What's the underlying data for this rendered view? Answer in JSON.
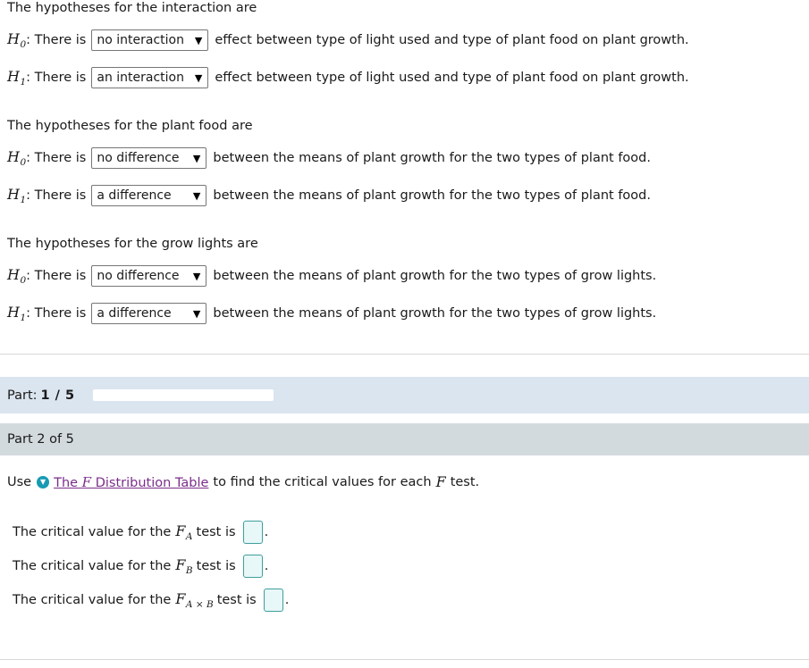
{
  "hypotheses_sections": [
    {
      "intro": "The hypotheses for the interaction are",
      "rows": [
        {
          "symbol": "H",
          "subscript": "0",
          "text_before": ": There is",
          "selected": "no interaction",
          "options": [
            "no interaction",
            "an interaction"
          ],
          "text_after": "effect between type of light used and type of plant food on plant growth."
        },
        {
          "symbol": "H",
          "subscript": "1",
          "text_before": ": There is",
          "selected": "an interaction",
          "options": [
            "no interaction",
            "an interaction"
          ],
          "text_after": "effect between type of light used and type of plant food on plant growth."
        }
      ]
    },
    {
      "intro": "The hypotheses for the plant food are",
      "rows": [
        {
          "symbol": "H",
          "subscript": "0",
          "text_before": ": There is",
          "selected": "no difference",
          "options": [
            "no difference",
            "a difference"
          ],
          "text_after": "between the means of plant growth for the two types of plant food."
        },
        {
          "symbol": "H",
          "subscript": "1",
          "text_before": ": There is",
          "selected": "a difference",
          "options": [
            "no difference",
            "a difference"
          ],
          "text_after": "between the means of plant growth for the two types of plant food."
        }
      ]
    },
    {
      "intro": "The hypotheses for the grow lights are",
      "rows": [
        {
          "symbol": "H",
          "subscript": "0",
          "text_before": ": There is",
          "selected": "no difference",
          "options": [
            "no difference",
            "a difference"
          ],
          "text_after": "between the means of plant growth for the two types of grow lights."
        },
        {
          "symbol": "H",
          "subscript": "1",
          "text_before": ": There is",
          "selected": "a difference",
          "options": [
            "no difference",
            "a difference"
          ],
          "text_after": "between the means of plant growth for the two types of grow lights."
        }
      ]
    }
  ],
  "progress": {
    "label": "Part:",
    "count": "1 / 5",
    "current": 1,
    "total": 5,
    "percent": 20,
    "fill_color": "#4a7ebb",
    "band_color": "#dbe5f0"
  },
  "part_header": {
    "title": "Part 2 of 5",
    "band_color": "#d3dade"
  },
  "question": {
    "use_word": "Use",
    "help_icon": "chevron-down-circle-icon",
    "link_prefix": "The ",
    "link_symbol": "F",
    "link_suffix": " Distribution Table",
    "tail_before": "to find the critical values for each",
    "tail_symbol": "F",
    "tail_after": "test.",
    "link_color": "#7b2d8b",
    "icon_color": "#189ab4",
    "critical_values": [
      {
        "text_before": "The critical value for the",
        "symbol": "F",
        "subscript": "A",
        "text_after": "test is",
        "value": "",
        "period": "."
      },
      {
        "text_before": "The critical value for the",
        "symbol": "F",
        "subscript": "B",
        "text_after": "test is",
        "value": "",
        "period": "."
      },
      {
        "text_before": "The critical value for the",
        "symbol": "F",
        "subscript": "A × B",
        "text_after": "test is",
        "value": "",
        "period": "."
      }
    ]
  }
}
